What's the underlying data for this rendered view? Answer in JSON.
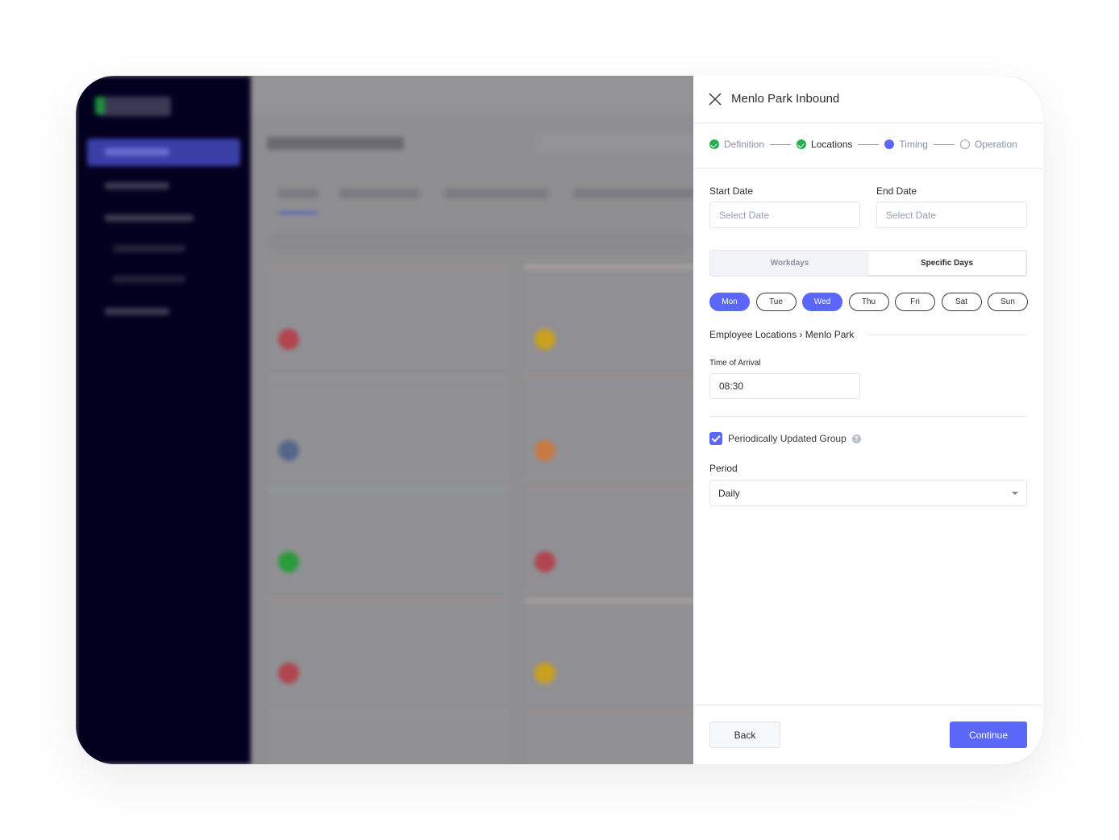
{
  "panel": {
    "title": "Menlo Park Inbound",
    "steps": [
      {
        "label": "Definition",
        "state": "done"
      },
      {
        "label": "Locations",
        "state": "done"
      },
      {
        "label": "Timing",
        "state": "current"
      },
      {
        "label": "Operation",
        "state": "todo"
      }
    ],
    "start_date": {
      "label": "Start Date",
      "placeholder": "Select Date",
      "value": ""
    },
    "end_date": {
      "label": "End Date",
      "placeholder": "Select Date",
      "value": ""
    },
    "day_mode": {
      "options": [
        "Workdays",
        "Specific Days"
      ],
      "selected": "Specific Days"
    },
    "days": [
      {
        "label": "Mon",
        "selected": true
      },
      {
        "label": "Tue",
        "selected": false
      },
      {
        "label": "Wed",
        "selected": true
      },
      {
        "label": "Thu",
        "selected": false
      },
      {
        "label": "Fri",
        "selected": false
      },
      {
        "label": "Sat",
        "selected": false
      },
      {
        "label": "Sun",
        "selected": false
      }
    ],
    "section_title": "Employee Locations › Menlo Park",
    "time_of_arrival": {
      "label": "Time of Arrival",
      "value": "08:30"
    },
    "periodic": {
      "label": "Periodically Updated Group",
      "checked": true,
      "help_icon": "question-circle-icon"
    },
    "period": {
      "label": "Period",
      "value": "Daily"
    },
    "back_label": "Back",
    "continue_label": "Continue"
  },
  "colors": {
    "accent": "#5a67f8",
    "success": "#22b14c",
    "sidebar": "#03001f"
  }
}
